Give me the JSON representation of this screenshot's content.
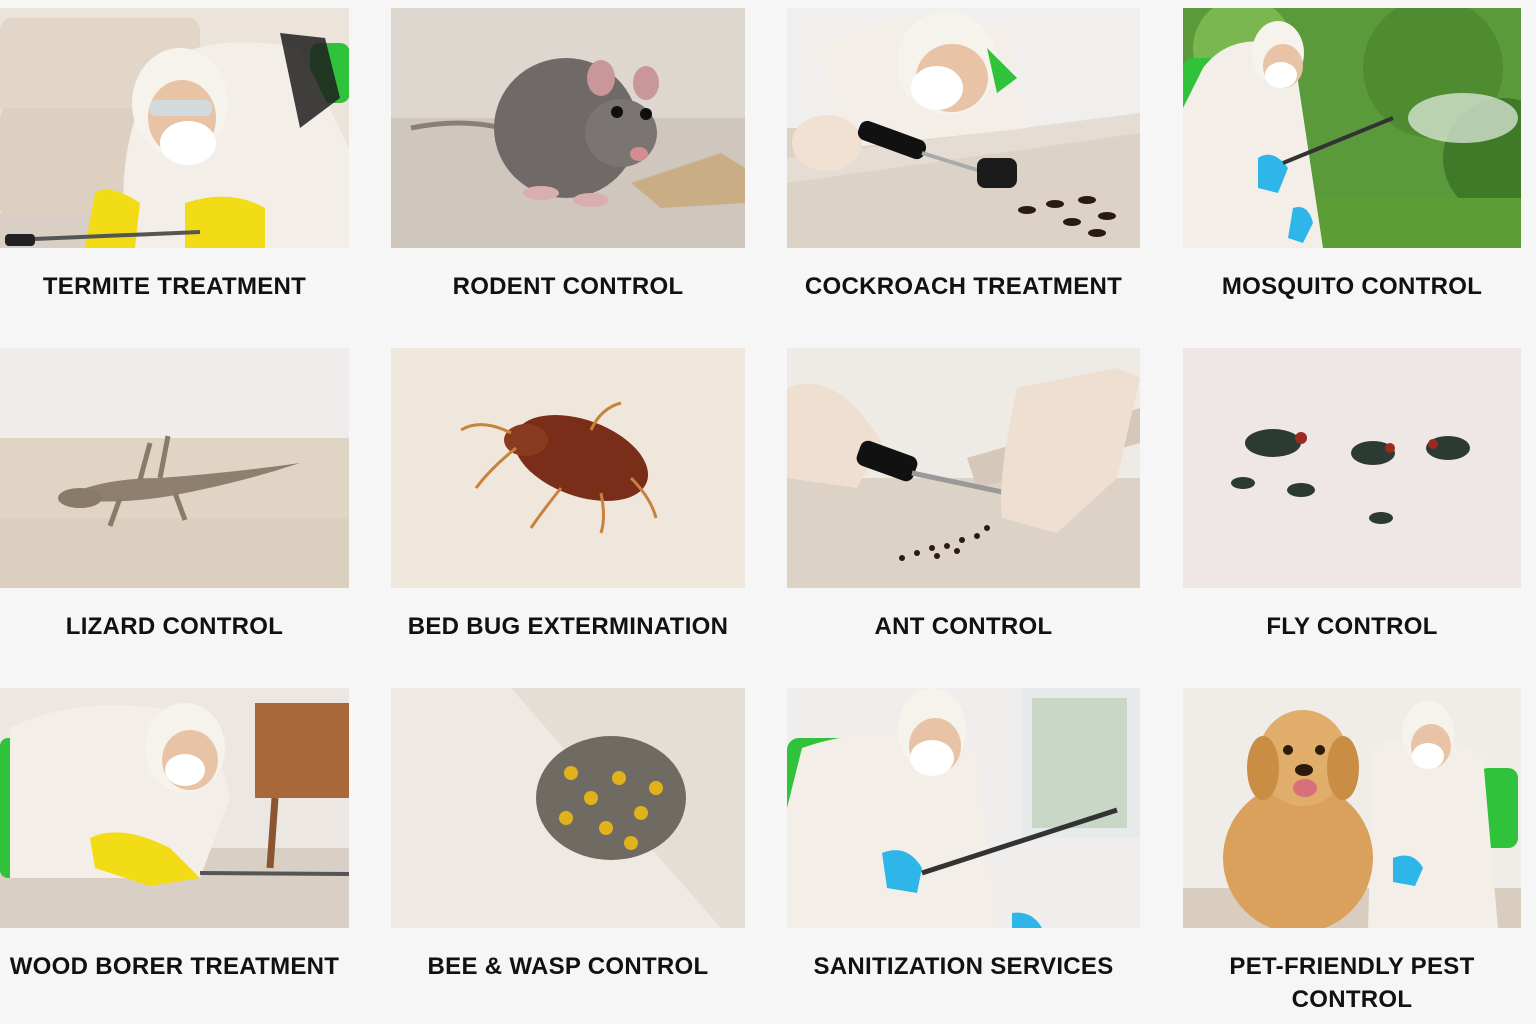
{
  "services": [
    {
      "label": "TERMITE TREATMENT",
      "icon": "technician-spraying-under-sofa"
    },
    {
      "label": "RODENT CONTROL",
      "icon": "rat"
    },
    {
      "label": "COCKROACH TREATMENT",
      "icon": "technician-spraying-cockroaches"
    },
    {
      "label": "MOSQUITO CONTROL",
      "icon": "technician-fogging-garden"
    },
    {
      "label": "LIZARD CONTROL",
      "icon": "lizard"
    },
    {
      "label": "BED BUG EXTERMINATION",
      "icon": "bed-bug"
    },
    {
      "label": "ANT CONTROL",
      "icon": "hands-spraying-ants"
    },
    {
      "label": "FLY CONTROL",
      "icon": "flies"
    },
    {
      "label": "WOOD BORER TREATMENT",
      "icon": "technician-spraying-furniture"
    },
    {
      "label": "BEE & WASP CONTROL",
      "icon": "wasp-nest"
    },
    {
      "label": "SANITIZATION SERVICES",
      "icon": "technician-sanitizing-room"
    },
    {
      "label": "PET-FRIENDLY PEST CONTROL",
      "icon": "technician-with-dog"
    }
  ],
  "colors": {
    "background": "#f6f6f6",
    "label_text": "#111111",
    "suit_white": "#f3eee8",
    "sprayer_green": "#2fc23a",
    "glove_yellow": "#f2dc16",
    "glove_blue": "#2eb6e8"
  }
}
